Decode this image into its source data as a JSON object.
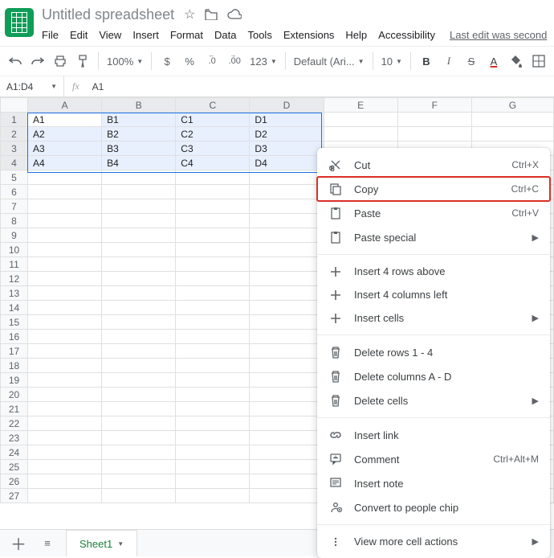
{
  "header": {
    "title": "Untitled spreadsheet",
    "menus": [
      "File",
      "Edit",
      "View",
      "Insert",
      "Format",
      "Data",
      "Tools",
      "Extensions",
      "Help",
      "Accessibility"
    ],
    "last_edit": "Last edit was second"
  },
  "toolbar": {
    "zoom": "100%",
    "currency": "$",
    "percent": "%",
    "dec_dec": ".0",
    "inc_dec": ".00",
    "numfmt": "123",
    "font": "Default (Ari...",
    "font_size": "10",
    "bold": "B",
    "italic": "I",
    "strike": "S",
    "textcolor": "A"
  },
  "formula_bar": {
    "range": "A1:D4",
    "fx": "fx",
    "value": "A1"
  },
  "grid": {
    "columns": [
      "A",
      "B",
      "C",
      "D",
      "E",
      "F",
      "G"
    ],
    "rows": [
      1,
      2,
      3,
      4,
      5,
      6,
      7,
      8,
      9,
      10,
      11,
      12,
      13,
      14,
      15,
      16,
      17,
      18,
      19,
      20,
      21,
      22,
      23,
      24,
      25,
      26,
      27
    ],
    "selected_columns": [
      "A",
      "B",
      "C",
      "D"
    ],
    "selected_rows": [
      1,
      2,
      3,
      4
    ],
    "active_cell": "A1",
    "cells": {
      "A1": "A1",
      "B1": "B1",
      "C1": "C1",
      "D1": "D1",
      "A2": "A2",
      "B2": "B2",
      "C2": "C2",
      "D2": "D2",
      "A3": "A3",
      "B3": "B3",
      "C3": "C3",
      "D3": "D3",
      "A4": "A4",
      "B4": "B4",
      "C4": "C4",
      "D4": "D4"
    }
  },
  "context_menu": {
    "items": [
      {
        "icon": "cut-icon",
        "label": "Cut",
        "shortcut": "Ctrl+X"
      },
      {
        "icon": "copy-icon",
        "label": "Copy",
        "shortcut": "Ctrl+C",
        "highlighted": true
      },
      {
        "icon": "paste-icon",
        "label": "Paste",
        "shortcut": "Ctrl+V"
      },
      {
        "icon": "paste-icon",
        "label": "Paste special",
        "submenu": true
      },
      {
        "sep": true
      },
      {
        "icon": "plus-icon",
        "label": "Insert 4 rows above"
      },
      {
        "icon": "plus-icon",
        "label": "Insert 4 columns left"
      },
      {
        "icon": "plus-icon",
        "label": "Insert cells",
        "submenu": true
      },
      {
        "sep": true
      },
      {
        "icon": "trash-icon",
        "label": "Delete rows 1 - 4"
      },
      {
        "icon": "trash-icon",
        "label": "Delete columns A - D"
      },
      {
        "icon": "trash-icon",
        "label": "Delete cells",
        "submenu": true
      },
      {
        "sep": true
      },
      {
        "icon": "link-icon",
        "label": "Insert link"
      },
      {
        "icon": "comment-icon",
        "label": "Comment",
        "shortcut": "Ctrl+Alt+M"
      },
      {
        "icon": "note-icon",
        "label": "Insert note"
      },
      {
        "icon": "person-icon",
        "label": "Convert to people chip"
      },
      {
        "sep": true
      },
      {
        "icon": "more-icon",
        "label": "View more cell actions",
        "submenu": true
      }
    ]
  },
  "tabs": {
    "sheet1": "Sheet1"
  }
}
